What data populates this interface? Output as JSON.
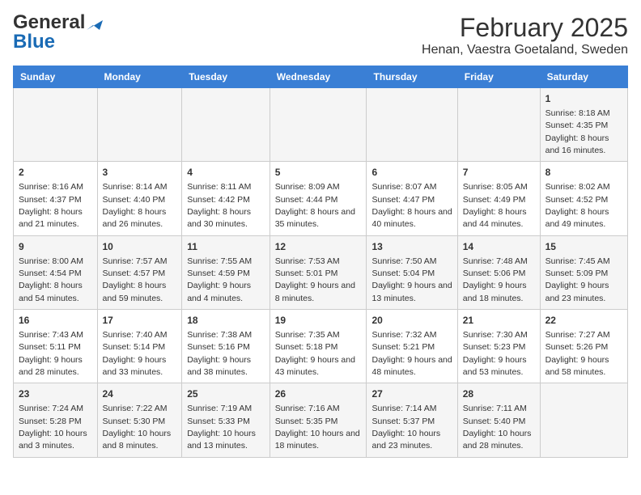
{
  "header": {
    "logo_general": "General",
    "logo_blue": "Blue",
    "title": "February 2025",
    "subtitle": "Henan, Vaestra Goetaland, Sweden"
  },
  "weekdays": [
    "Sunday",
    "Monday",
    "Tuesday",
    "Wednesday",
    "Thursday",
    "Friday",
    "Saturday"
  ],
  "weeks": [
    [
      {
        "day": "",
        "info": ""
      },
      {
        "day": "",
        "info": ""
      },
      {
        "day": "",
        "info": ""
      },
      {
        "day": "",
        "info": ""
      },
      {
        "day": "",
        "info": ""
      },
      {
        "day": "",
        "info": ""
      },
      {
        "day": "1",
        "info": "Sunrise: 8:18 AM\nSunset: 4:35 PM\nDaylight: 8 hours and 16 minutes."
      }
    ],
    [
      {
        "day": "2",
        "info": "Sunrise: 8:16 AM\nSunset: 4:37 PM\nDaylight: 8 hours and 21 minutes."
      },
      {
        "day": "3",
        "info": "Sunrise: 8:14 AM\nSunset: 4:40 PM\nDaylight: 8 hours and 26 minutes."
      },
      {
        "day": "4",
        "info": "Sunrise: 8:11 AM\nSunset: 4:42 PM\nDaylight: 8 hours and 30 minutes."
      },
      {
        "day": "5",
        "info": "Sunrise: 8:09 AM\nSunset: 4:44 PM\nDaylight: 8 hours and 35 minutes."
      },
      {
        "day": "6",
        "info": "Sunrise: 8:07 AM\nSunset: 4:47 PM\nDaylight: 8 hours and 40 minutes."
      },
      {
        "day": "7",
        "info": "Sunrise: 8:05 AM\nSunset: 4:49 PM\nDaylight: 8 hours and 44 minutes."
      },
      {
        "day": "8",
        "info": "Sunrise: 8:02 AM\nSunset: 4:52 PM\nDaylight: 8 hours and 49 minutes."
      }
    ],
    [
      {
        "day": "9",
        "info": "Sunrise: 8:00 AM\nSunset: 4:54 PM\nDaylight: 8 hours and 54 minutes."
      },
      {
        "day": "10",
        "info": "Sunrise: 7:57 AM\nSunset: 4:57 PM\nDaylight: 8 hours and 59 minutes."
      },
      {
        "day": "11",
        "info": "Sunrise: 7:55 AM\nSunset: 4:59 PM\nDaylight: 9 hours and 4 minutes."
      },
      {
        "day": "12",
        "info": "Sunrise: 7:53 AM\nSunset: 5:01 PM\nDaylight: 9 hours and 8 minutes."
      },
      {
        "day": "13",
        "info": "Sunrise: 7:50 AM\nSunset: 5:04 PM\nDaylight: 9 hours and 13 minutes."
      },
      {
        "day": "14",
        "info": "Sunrise: 7:48 AM\nSunset: 5:06 PM\nDaylight: 9 hours and 18 minutes."
      },
      {
        "day": "15",
        "info": "Sunrise: 7:45 AM\nSunset: 5:09 PM\nDaylight: 9 hours and 23 minutes."
      }
    ],
    [
      {
        "day": "16",
        "info": "Sunrise: 7:43 AM\nSunset: 5:11 PM\nDaylight: 9 hours and 28 minutes."
      },
      {
        "day": "17",
        "info": "Sunrise: 7:40 AM\nSunset: 5:14 PM\nDaylight: 9 hours and 33 minutes."
      },
      {
        "day": "18",
        "info": "Sunrise: 7:38 AM\nSunset: 5:16 PM\nDaylight: 9 hours and 38 minutes."
      },
      {
        "day": "19",
        "info": "Sunrise: 7:35 AM\nSunset: 5:18 PM\nDaylight: 9 hours and 43 minutes."
      },
      {
        "day": "20",
        "info": "Sunrise: 7:32 AM\nSunset: 5:21 PM\nDaylight: 9 hours and 48 minutes."
      },
      {
        "day": "21",
        "info": "Sunrise: 7:30 AM\nSunset: 5:23 PM\nDaylight: 9 hours and 53 minutes."
      },
      {
        "day": "22",
        "info": "Sunrise: 7:27 AM\nSunset: 5:26 PM\nDaylight: 9 hours and 58 minutes."
      }
    ],
    [
      {
        "day": "23",
        "info": "Sunrise: 7:24 AM\nSunset: 5:28 PM\nDaylight: 10 hours and 3 minutes."
      },
      {
        "day": "24",
        "info": "Sunrise: 7:22 AM\nSunset: 5:30 PM\nDaylight: 10 hours and 8 minutes."
      },
      {
        "day": "25",
        "info": "Sunrise: 7:19 AM\nSunset: 5:33 PM\nDaylight: 10 hours and 13 minutes."
      },
      {
        "day": "26",
        "info": "Sunrise: 7:16 AM\nSunset: 5:35 PM\nDaylight: 10 hours and 18 minutes."
      },
      {
        "day": "27",
        "info": "Sunrise: 7:14 AM\nSunset: 5:37 PM\nDaylight: 10 hours and 23 minutes."
      },
      {
        "day": "28",
        "info": "Sunrise: 7:11 AM\nSunset: 5:40 PM\nDaylight: 10 hours and 28 minutes."
      },
      {
        "day": "",
        "info": ""
      }
    ]
  ]
}
